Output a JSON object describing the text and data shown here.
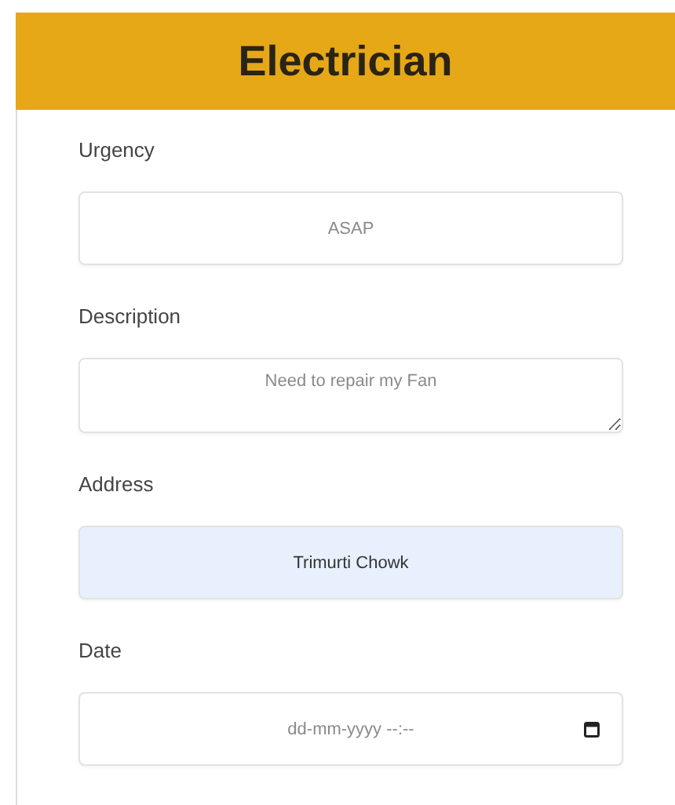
{
  "header": {
    "title": "Electrician"
  },
  "fields": [
    {
      "kind": "text",
      "label": "Urgency",
      "placeholder": "ASAP",
      "focused": false
    },
    {
      "kind": "textarea",
      "label": "Description",
      "placeholder": "Need to repair my Fan",
      "focused": false
    },
    {
      "kind": "text",
      "label": "Address",
      "value": "Trimurti Chowk",
      "focused": true
    },
    {
      "kind": "datetime",
      "label": "Date",
      "placeholder": "dd-mm-yyyy --:--",
      "focused": false
    }
  ]
}
